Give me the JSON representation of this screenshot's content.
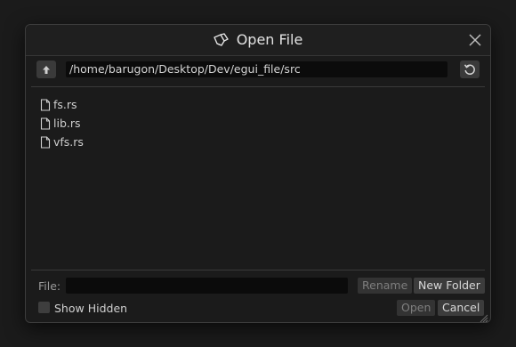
{
  "dialog": {
    "title": "Open File",
    "icon": "open-folder-icon"
  },
  "toolbar": {
    "up_icon": "arrow-up-icon",
    "path": "/home/barugon/Desktop/Dev/egui_file/src",
    "refresh_icon": "refresh-icon"
  },
  "files": [
    {
      "name": "fs.rs",
      "icon": "file-icon"
    },
    {
      "name": "lib.rs",
      "icon": "file-icon"
    },
    {
      "name": "vfs.rs",
      "icon": "file-icon"
    }
  ],
  "footer": {
    "file_label": "File:",
    "file_value": "",
    "rename_label": "Rename",
    "new_folder_label": "New Folder",
    "show_hidden_label": "Show Hidden",
    "show_hidden_checked": false,
    "open_label": "Open",
    "cancel_label": "Cancel"
  },
  "colors": {
    "background": "#1b1b1b",
    "input_bg": "#0b0b0b",
    "button_bg": "#3c3c3c",
    "disabled_text": "#7e7e7e"
  }
}
